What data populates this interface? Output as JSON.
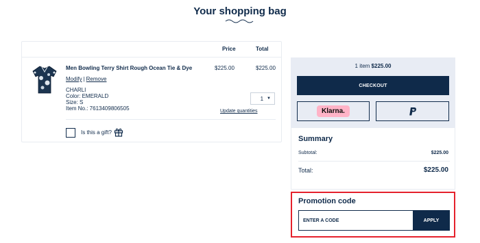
{
  "page": {
    "title": "Your shopping bag"
  },
  "cart": {
    "columns": {
      "price": "Price",
      "total": "Total"
    },
    "item": {
      "name": "Men Bowling Terry Shirt Rough Ocean Tie & Dye",
      "price": "$225.00",
      "total": "$225.00",
      "modify_label": "Modify",
      "separator": "|",
      "remove_label": "Remove",
      "brand": "CHARLI",
      "color": "Color: EMERALD",
      "size": "Size: S",
      "item_no": "Item No.: 7613409806505",
      "quantity": "1",
      "update_label": "Update quantities"
    },
    "gift_label": "Is this a gift?"
  },
  "checkout": {
    "items_text": "1 item",
    "items_amount": "$225.00",
    "checkout_label": "CHECKOUT",
    "klarna_label": "Klarna."
  },
  "summary": {
    "title": "Summary",
    "subtotal_label": "Subtotal:",
    "subtotal_value": "$225.00",
    "total_label": "Total:",
    "total_value": "$225.00"
  },
  "promo": {
    "title": "Promotion code",
    "placeholder": "ENTER A CODE",
    "apply_label": "APPLY"
  },
  "colors": {
    "navy": "#0f2a4a",
    "checkout_bg": "#e8ecf4",
    "klarna_pink": "#ffb3c7",
    "highlight_red": "#e5202b"
  },
  "icons": [
    "wave-divider-icon",
    "gift-icon",
    "paypal-icon",
    "chevron-down-icon"
  ]
}
